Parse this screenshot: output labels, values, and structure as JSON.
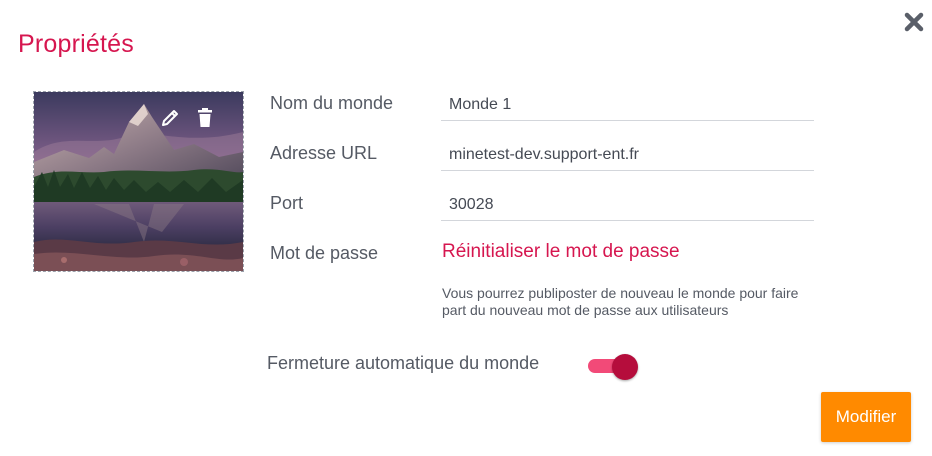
{
  "dialog": {
    "title": "Propriétés",
    "close_icon": "close-x-icon"
  },
  "image": {
    "edit_icon": "pencil-icon",
    "delete_icon": "trash-icon"
  },
  "fields": {
    "name": {
      "label": "Nom du monde",
      "value": "Monde 1"
    },
    "url": {
      "label": "Adresse URL",
      "value": "minetest-dev.support-ent.fr"
    },
    "port": {
      "label": "Port",
      "value": "30028"
    },
    "password": {
      "label": "Mot de passe",
      "reset_link": "Réinitialiser le mot de passe",
      "help": "Vous pourrez publiposter de nouveau le monde pour faire part du nouveau mot de passe aux utilisateurs"
    }
  },
  "auto_close": {
    "label": "Fermeture automatique du monde",
    "enabled": true
  },
  "actions": {
    "submit_label": "Modifier"
  },
  "colors": {
    "accent": "#d6164f",
    "toggle_track": "#f24a78",
    "toggle_knob": "#b50d3c",
    "primary_button": "#ff8a00"
  }
}
